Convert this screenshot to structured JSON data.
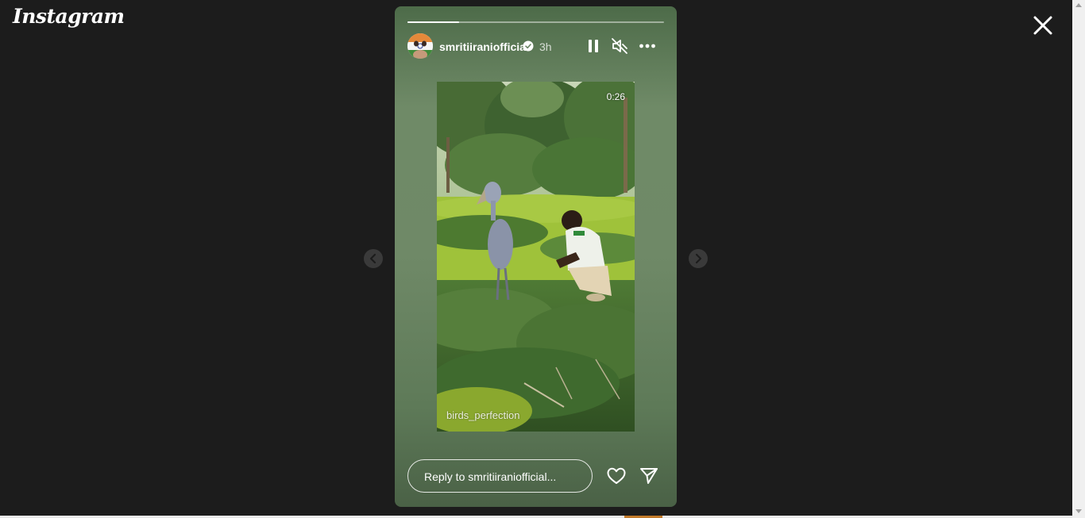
{
  "app": {
    "logo_text": "Instagram"
  },
  "icons": {
    "close": "close-icon",
    "prev": "chevron-left-icon",
    "next": "chevron-right-icon",
    "pause": "pause-icon",
    "mute": "speaker-muted-icon",
    "more": "more-horizontal-icon",
    "verified": "verified-badge-icon",
    "like": "heart-icon",
    "share": "send-icon"
  },
  "story": {
    "progress_fraction": 0.2,
    "username": "smritiiraniofficial",
    "timestamp": "3h",
    "video_duration": "0:26",
    "watermark": "birds_perfection",
    "reply_placeholder": "Reply to smritiiraniofficial..."
  },
  "colors": {
    "page_bg": "#1c1c1c",
    "story_bg": "#6f8a67",
    "verified": "#ffffff"
  }
}
